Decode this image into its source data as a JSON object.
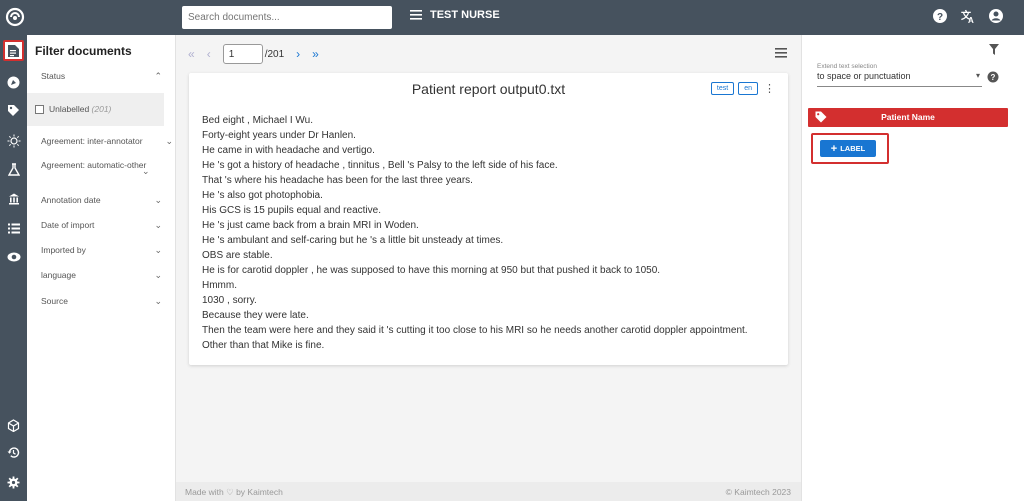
{
  "topbar": {
    "search_placeholder": "Search documents...",
    "project_name": "TEST NURSE",
    "icons": [
      "help-icon",
      "translate-icon",
      "account-icon"
    ]
  },
  "rail": {
    "items": [
      "documents-icon",
      "explore-icon",
      "labels-icon",
      "insights-icon",
      "experiments-icon",
      "bank-icon",
      "list-icon",
      "visibility-icon",
      "cube-icon",
      "history-icon",
      "settings-icon"
    ],
    "active": "documents-icon"
  },
  "filter": {
    "title": "Filter documents",
    "status_label": "Status",
    "unlabelled_label": "Unlabelled",
    "unlabelled_count": "(201)",
    "rows": [
      "Agreement: inter-annotator",
      "Agreement: automatic-other",
      "Annotation date",
      "Date of import",
      "Imported by",
      "language",
      "Source"
    ]
  },
  "pager": {
    "first": "«",
    "prev": "‹",
    "next": "›",
    "last": "»",
    "current_page": "1",
    "total": "/201"
  },
  "document": {
    "title": "Patient report output0.txt",
    "tags": [
      "test",
      "en"
    ],
    "lines": [
      "Bed eight , Michael I Wu.",
      "Forty-eight years under Dr Hanlen.",
      "He came in with headache and vertigo.",
      "He 's got a history of headache , tinnitus , Bell 's Palsy to the left side of his face.",
      "That 's where his headache has been for the last three years.",
      "He 's also got photophobia.",
      "His GCS is 15 pupils equal and reactive.",
      "He 's just came back from a brain MRI in Woden.",
      "He 's ambulant and self-caring but he 's a little bit unsteady at times.",
      "OBS are stable.",
      "He is for carotid doppler , he was supposed to have this morning at 950 but that pushed it back to 1050.",
      "Hmmm.",
      "1030 , sorry.",
      "Because they were late.",
      "Then the team were here and they said it 's cutting it too close to his MRI so he needs another carotid doppler appointment.",
      "Other than that Mike is fine."
    ]
  },
  "footer": {
    "left": "Made with ♡ by Kaimtech",
    "right": "©  Kaimtech 2023"
  },
  "right_panel": {
    "extend_label": "Extend text selection",
    "extend_value": "to space or punctuation",
    "entity_name": "Patient Name",
    "entity_color": "#d32f2f",
    "add_label_text": "LABEL",
    "add_label_plus": "+"
  }
}
